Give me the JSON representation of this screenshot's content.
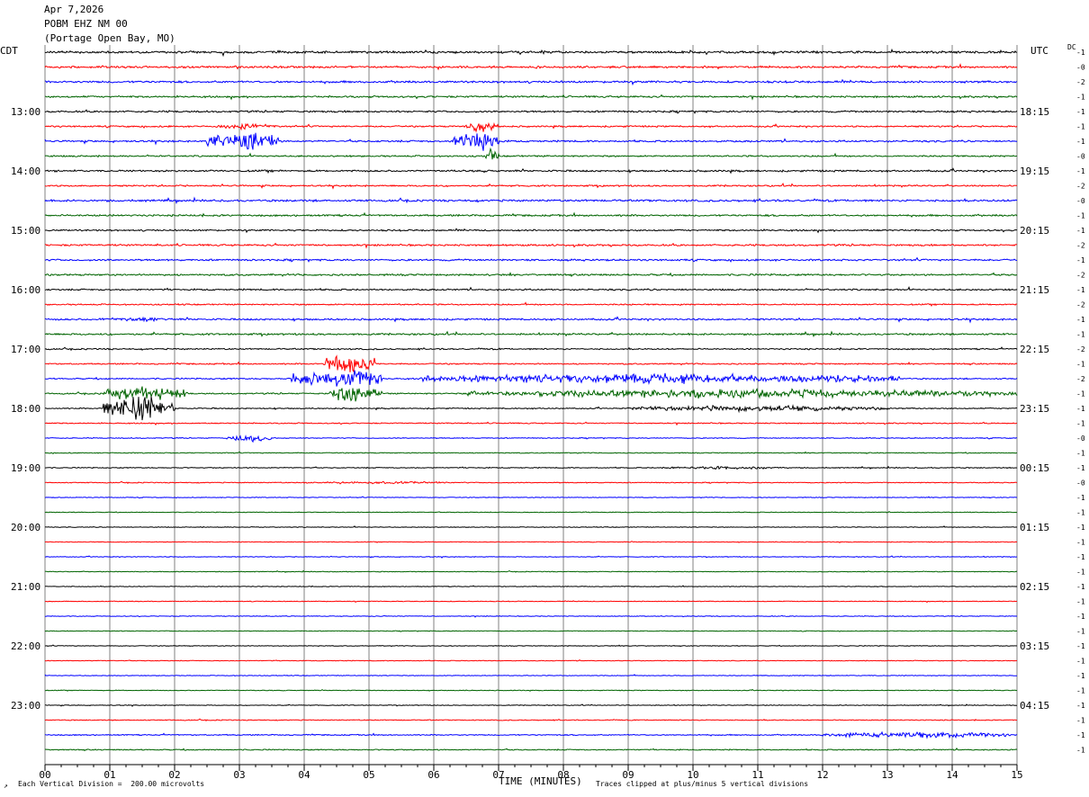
{
  "header": {
    "date": "Apr 7,2026",
    "channel": "POBM EHZ NM 00",
    "location": "(Portage Open Bay, MO)"
  },
  "left_zone": "CDT",
  "right_zone": "UTC",
  "dc_label": "DC",
  "footer": {
    "scale_note": "Each Vertical Division =  200.00 microvolts",
    "xlabel": "TIME (MINUTES)",
    "clip_note": "Traces clipped at plus/minus 5 vertical divisions",
    "corner_mark": "↗"
  },
  "colors": {
    "trace_cycle": [
      "#000000",
      "#ff0000",
      "#0000ff",
      "#006400"
    ],
    "grid": "#808080"
  },
  "chart_data": {
    "type": "line",
    "title": "",
    "xlabel": "TIME (MINUTES)",
    "xlim": [
      0,
      15
    ],
    "x_ticks": [
      "00",
      "01",
      "02",
      "03",
      "04",
      "05",
      "06",
      "07",
      "08",
      "09",
      "10",
      "11",
      "12",
      "13",
      "14",
      "15"
    ],
    "row_minutes": 15,
    "num_rows": 48,
    "left_hour_labels": [
      "13:00",
      "14:00",
      "15:00",
      "16:00",
      "17:00",
      "18:00",
      "19:00",
      "20:00",
      "21:00",
      "22:00",
      "23:00"
    ],
    "right_hour_labels": [
      "18:15",
      "19:15",
      "20:15",
      "21:15",
      "22:15",
      "23:15",
      "00:15",
      "01:15",
      "02:15",
      "03:15",
      "04:15"
    ],
    "hour_label_first_row": 4,
    "dc_offsets": [
      "-1",
      "-0",
      "-2",
      "-1",
      "-1",
      "-1",
      "-1",
      "-0",
      "-1",
      "-2",
      "-0",
      "-1",
      "-1",
      "-2",
      "-1",
      "-2",
      "-1",
      "-2",
      "-1",
      "-1",
      "-2",
      "-1",
      "-2",
      "-1",
      "-1",
      "-1",
      "-0",
      "-1",
      "-1",
      "-0",
      "-1",
      "-1",
      "-1",
      "-1",
      "-1",
      "-1",
      "-1",
      "-1",
      "-1",
      "-1",
      "-1",
      "-1",
      "-1",
      "-1",
      "-1",
      "-1",
      "-1",
      "-1"
    ],
    "base_noise": [
      1.0,
      0.9,
      0.9,
      0.8,
      0.8,
      0.7,
      0.8,
      0.7,
      0.8,
      0.7,
      0.9,
      0.8,
      0.7,
      0.8,
      0.8,
      0.8,
      0.7,
      0.6,
      0.8,
      0.8,
      0.6,
      0.6,
      0.6,
      0.6,
      0.5,
      0.5,
      0.4,
      0.4,
      0.4,
      0.4,
      0.3,
      0.3,
      0.3,
      0.3,
      0.3,
      0.3,
      0.3,
      0.3,
      0.3,
      0.3,
      0.3,
      0.3,
      0.3,
      0.3,
      0.3,
      0.4,
      0.5,
      0.5
    ],
    "events": [
      {
        "row": 5,
        "start": 2.6,
        "end": 3.6,
        "amp": 4
      },
      {
        "row": 6,
        "start": 2.5,
        "end": 3.6,
        "amp": 16
      },
      {
        "row": 5,
        "start": 6.5,
        "end": 7.0,
        "amp": 8
      },
      {
        "row": 6,
        "start": 6.3,
        "end": 7.0,
        "amp": 14
      },
      {
        "row": 7,
        "start": 6.8,
        "end": 7.0,
        "amp": 10
      },
      {
        "row": 18,
        "start": 0.8,
        "end": 2.0,
        "amp": 3
      },
      {
        "row": 21,
        "start": 4.3,
        "end": 5.1,
        "amp": 14
      },
      {
        "row": 22,
        "start": 3.8,
        "end": 5.2,
        "amp": 14
      },
      {
        "row": 22,
        "start": 5.8,
        "end": 13.2,
        "amp": 7
      },
      {
        "row": 23,
        "start": 0.9,
        "end": 2.2,
        "amp": 10
      },
      {
        "row": 23,
        "start": 4.4,
        "end": 5.2,
        "amp": 12
      },
      {
        "row": 23,
        "start": 6.5,
        "end": 15.0,
        "amp": 6
      },
      {
        "row": 24,
        "start": 0.9,
        "end": 2.0,
        "amp": 18
      },
      {
        "row": 24,
        "start": 9.0,
        "end": 13.0,
        "amp": 4
      },
      {
        "row": 26,
        "start": 2.8,
        "end": 3.5,
        "amp": 5
      },
      {
        "row": 28,
        "start": 9.5,
        "end": 11.5,
        "amp": 2
      },
      {
        "row": 29,
        "start": 4.0,
        "end": 6.5,
        "amp": 1.5
      },
      {
        "row": 46,
        "start": 12.0,
        "end": 15.0,
        "amp": 4
      }
    ]
  }
}
